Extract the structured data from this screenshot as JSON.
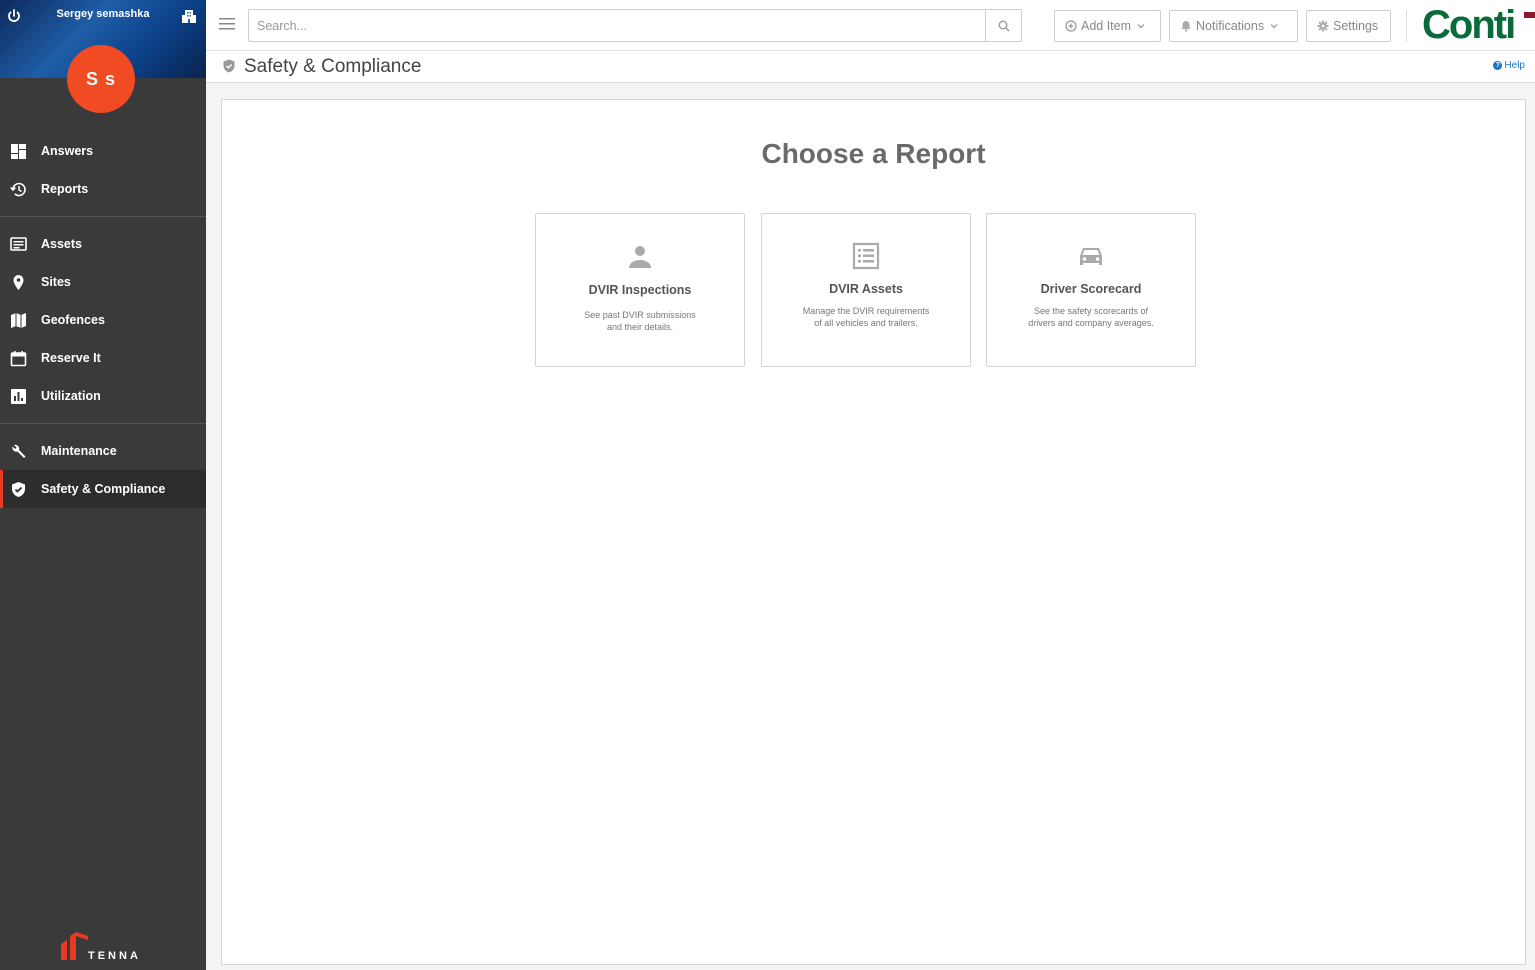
{
  "sidebar": {
    "user_name": "Sergey semashka",
    "avatar_initials": "S s",
    "items": [
      {
        "label": "Answers"
      },
      {
        "label": "Reports"
      },
      {
        "label": "Assets"
      },
      {
        "label": "Sites"
      },
      {
        "label": "Geofences"
      },
      {
        "label": "Reserve It"
      },
      {
        "label": "Utilization"
      },
      {
        "label": "Maintenance"
      },
      {
        "label": "Safety & Compliance"
      }
    ],
    "active_item": "Safety & Compliance",
    "logo_text": "TENNA"
  },
  "topbar": {
    "search_placeholder": "Search...",
    "add_item_label": "Add Item",
    "notifications_label": "Notifications",
    "settings_label": "Settings",
    "brand_text": "Conti"
  },
  "page": {
    "title": "Safety & Compliance",
    "help_label": "Help"
  },
  "main": {
    "heading": "Choose a Report",
    "cards": [
      {
        "title": "DVIR Inspections",
        "description": "See past DVIR submissions and their details.",
        "icon": "person-icon"
      },
      {
        "title": "DVIR Assets",
        "description": "Manage the DVIR requirements of all vehicles and trailers.",
        "icon": "list-icon"
      },
      {
        "title": "Driver Scorecard",
        "description": "See the safety scorecards of drivers and company averages.",
        "icon": "car-icon"
      }
    ]
  },
  "colors": {
    "sidebar_bg": "#3a3a3a",
    "accent_red": "#e63a25",
    "avatar_bg": "#f04b23",
    "brand_green": "#0a6b3a",
    "help_blue": "#1a73c8"
  }
}
